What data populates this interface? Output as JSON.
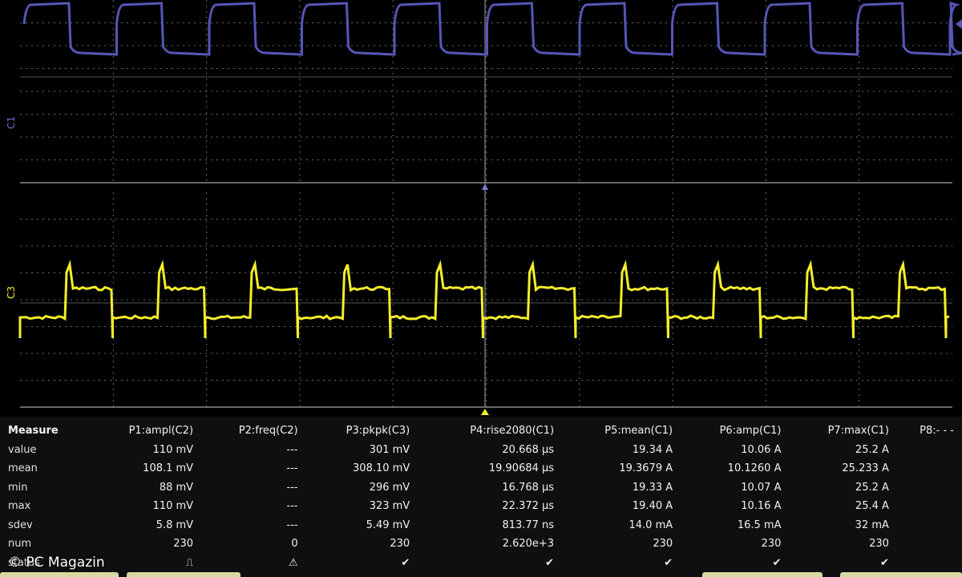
{
  "colors": {
    "c1": "#5656b8",
    "c3": "#f4ee2a",
    "grid": "#6a6a6a",
    "background": "#000000"
  },
  "channels": {
    "c1_label": "C1",
    "c3_label": "C3"
  },
  "measure": {
    "title": "Measure",
    "headers": [
      "P1:ampl(C2)",
      "P2:freq(C2)",
      "P3:pkpk(C3)",
      "P4:rise2080(C1)",
      "P5:mean(C1)",
      "P6:amp(C1)",
      "P7:max(C1)",
      "P8:- - -"
    ],
    "rows": [
      {
        "label": "value",
        "cells": [
          "110 mV",
          "---",
          "301 mV",
          "20.668 µs",
          "19.34 A",
          "10.06 A",
          "25.2 A",
          ""
        ]
      },
      {
        "label": "mean",
        "cells": [
          "108.1 mV",
          "---",
          "308.10 mV",
          "19.90684 µs",
          "19.3679 A",
          "10.1260 A",
          "25.233 A",
          ""
        ]
      },
      {
        "label": "min",
        "cells": [
          "88 mV",
          "---",
          "296 mV",
          "16.768 µs",
          "19.33 A",
          "10.07 A",
          "25.2 A",
          ""
        ]
      },
      {
        "label": "max",
        "cells": [
          "110 mV",
          "---",
          "323 mV",
          "22.372 µs",
          "19.40 A",
          "10.16 A",
          "25.4 A",
          ""
        ]
      },
      {
        "label": "sdev",
        "cells": [
          "5.8 mV",
          "---",
          "5.49 mV",
          "813.77 ns",
          "14.0 mA",
          "16.5 mA",
          "32 mA",
          ""
        ]
      },
      {
        "label": "num",
        "cells": [
          "230",
          "0",
          "230",
          "2.620e+3",
          "230",
          "230",
          "230",
          ""
        ]
      },
      {
        "label": "status",
        "cells": [
          "⎍",
          "⚠",
          "✔",
          "✔",
          "✔",
          "✔",
          "✔",
          ""
        ]
      }
    ]
  },
  "watermark": "© PC Magazin"
}
